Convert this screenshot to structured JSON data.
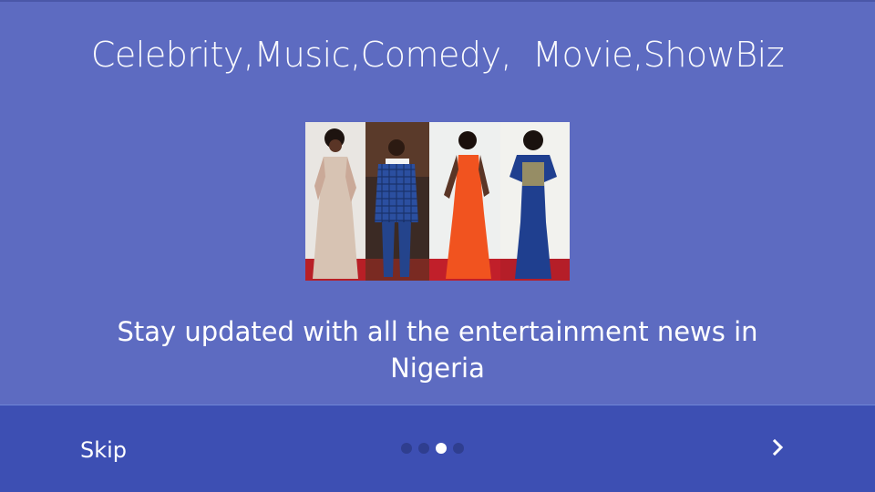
{
  "slide": {
    "heading": "Celebrity,Music,Comedy,  Movie,ShowBiz",
    "body": "Stay updated with all the entertainment news in Nigeria",
    "image": "celebrities-red-carpet-photo"
  },
  "footer": {
    "skip_label": "Skip",
    "page_count": 4,
    "current_page": 3,
    "next_icon": "chevron-right-icon"
  },
  "colors": {
    "background": "#5d6bc1",
    "footer": "#3d4fb3",
    "dot_inactive": "#2f3e8f",
    "dot_active": "#ffffff"
  }
}
